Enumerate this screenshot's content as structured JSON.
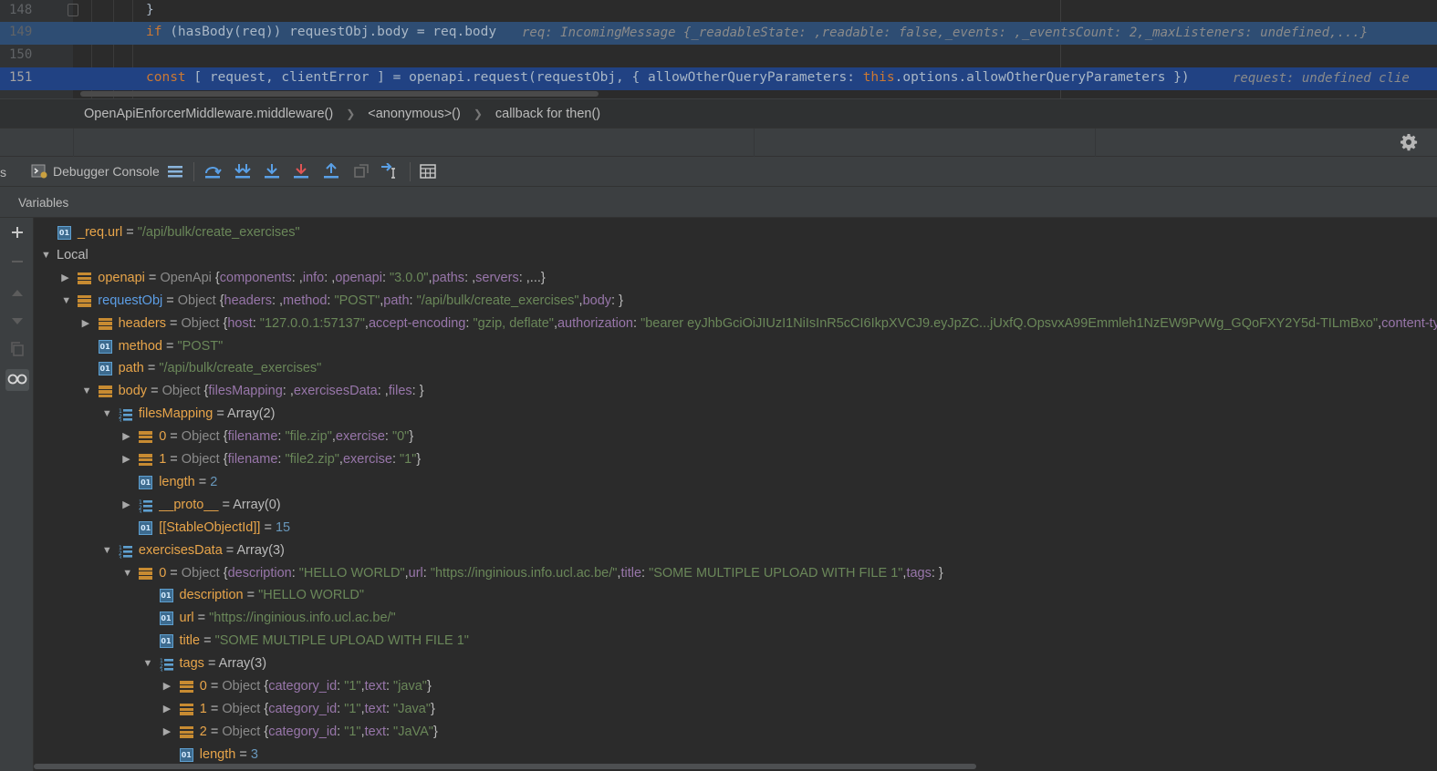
{
  "editor": {
    "lines": [
      {
        "num": "148",
        "code": "}"
      },
      {
        "num": "149",
        "code_kw": "if",
        "code_rest": " (hasBody(req)) requestObj.body = req.body",
        "inline": "req: IncomingMessage {_readableState: ,readable: false,_events: ,_eventsCount: 2,_maxListeners: undefined,...}"
      },
      {
        "num": "150",
        "code": ""
      },
      {
        "num": "151",
        "code_kw": "const",
        "code_mid": " [ request, clientError ] = openapi.request(requestObj, { allowOtherQueryParameters: ",
        "code_this": "this",
        "code_tail": ".options.allowOtherQueryParameters })",
        "inline": "request: undefined  clie"
      }
    ]
  },
  "breadcrumb": [
    "OpenApiEnforcerMiddleware.middleware()",
    "<anonymous>()",
    "callback for then()"
  ],
  "toolbar": {
    "console_label": "Debugger Console",
    "left_cut": "s"
  },
  "variables_title": "Variables",
  "tree": [
    {
      "depth": 0,
      "arrow": "",
      "icon": "prim",
      "name": "_req.url",
      "nameStyle": "orange",
      "value": [
        [
          "str",
          "\"/api/bulk/create_exercises\""
        ]
      ]
    },
    {
      "depth": 0,
      "arrow": "down",
      "icon": "",
      "name": "Local",
      "nameStyle": "plain",
      "value": []
    },
    {
      "depth": 1,
      "arrow": "right",
      "icon": "obj",
      "name": "openapi",
      "nameStyle": "orange",
      "value": [
        [
          "typ",
          "OpenApi "
        ],
        [
          "plain",
          "{"
        ],
        [
          "key",
          "components"
        ],
        [
          "plain",
          ": ,"
        ],
        [
          "key",
          "info"
        ],
        [
          "plain",
          ": ,"
        ],
        [
          "key",
          "openapi"
        ],
        [
          "plain",
          ": "
        ],
        [
          "str",
          "\"3.0.0\""
        ],
        [
          "plain",
          ","
        ],
        [
          "key",
          "paths"
        ],
        [
          "plain",
          ": ,"
        ],
        [
          "key",
          "servers"
        ],
        [
          "plain",
          ": ,...}"
        ]
      ]
    },
    {
      "depth": 1,
      "arrow": "down",
      "icon": "obj",
      "name": "requestObj",
      "nameStyle": "sel",
      "value": [
        [
          "typ",
          "Object "
        ],
        [
          "plain",
          "{"
        ],
        [
          "key",
          "headers"
        ],
        [
          "plain",
          ": ,"
        ],
        [
          "key",
          "method"
        ],
        [
          "plain",
          ": "
        ],
        [
          "str",
          "\"POST\""
        ],
        [
          "plain",
          ","
        ],
        [
          "key",
          "path"
        ],
        [
          "plain",
          ": "
        ],
        [
          "str",
          "\"/api/bulk/create_exercises\""
        ],
        [
          "plain",
          ","
        ],
        [
          "key",
          "body"
        ],
        [
          "plain",
          ": }"
        ]
      ]
    },
    {
      "depth": 2,
      "arrow": "right",
      "icon": "obj",
      "name": "headers",
      "nameStyle": "orange",
      "value": [
        [
          "typ",
          "Object "
        ],
        [
          "plain",
          "{"
        ],
        [
          "key",
          "host"
        ],
        [
          "plain",
          ": "
        ],
        [
          "str",
          "\"127.0.0.1:57137\""
        ],
        [
          "plain",
          ","
        ],
        [
          "key",
          "accept-encoding"
        ],
        [
          "plain",
          ": "
        ],
        [
          "str",
          "\"gzip, deflate\""
        ],
        [
          "plain",
          ","
        ],
        [
          "key",
          "authorization"
        ],
        [
          "plain",
          ": "
        ],
        [
          "str",
          "\"bearer eyJhbGciOiJIUzI1NiIsInR5cCI6IkpXVCJ9.eyJpZC...jUxfQ.OpsvxA99Emmleh1NzEW9PvWg_GQoFXY2Y5d-TILmBxo\""
        ],
        [
          "plain",
          ","
        ],
        [
          "key",
          "content-typ"
        ]
      ]
    },
    {
      "depth": 2,
      "arrow": "",
      "icon": "prim",
      "name": "method",
      "nameStyle": "orange",
      "value": [
        [
          "str",
          "\"POST\""
        ]
      ]
    },
    {
      "depth": 2,
      "arrow": "",
      "icon": "prim",
      "name": "path",
      "nameStyle": "orange",
      "value": [
        [
          "str",
          "\"/api/bulk/create_exercises\""
        ]
      ]
    },
    {
      "depth": 2,
      "arrow": "down",
      "icon": "obj",
      "name": "body",
      "nameStyle": "orange",
      "value": [
        [
          "typ",
          "Object "
        ],
        [
          "plain",
          "{"
        ],
        [
          "key",
          "filesMapping"
        ],
        [
          "plain",
          ": ,"
        ],
        [
          "key",
          "exercisesData"
        ],
        [
          "plain",
          ": ,"
        ],
        [
          "key",
          "files"
        ],
        [
          "plain",
          ": }"
        ]
      ]
    },
    {
      "depth": 3,
      "arrow": "down",
      "icon": "arr",
      "name": "filesMapping",
      "nameStyle": "orange",
      "value": [
        [
          "plain",
          "Array(2)"
        ]
      ]
    },
    {
      "depth": 4,
      "arrow": "right",
      "icon": "obj",
      "name": "0",
      "nameStyle": "orange",
      "value": [
        [
          "typ",
          "Object "
        ],
        [
          "plain",
          "{"
        ],
        [
          "key",
          "filename"
        ],
        [
          "plain",
          ": "
        ],
        [
          "str",
          "\"file.zip\""
        ],
        [
          "plain",
          ","
        ],
        [
          "key",
          "exercise"
        ],
        [
          "plain",
          ": "
        ],
        [
          "str",
          "\"0\""
        ],
        [
          "plain",
          "}"
        ]
      ]
    },
    {
      "depth": 4,
      "arrow": "right",
      "icon": "obj",
      "name": "1",
      "nameStyle": "orange",
      "value": [
        [
          "typ",
          "Object "
        ],
        [
          "plain",
          "{"
        ],
        [
          "key",
          "filename"
        ],
        [
          "plain",
          ": "
        ],
        [
          "str",
          "\"file2.zip\""
        ],
        [
          "plain",
          ","
        ],
        [
          "key",
          "exercise"
        ],
        [
          "plain",
          ": "
        ],
        [
          "str",
          "\"1\""
        ],
        [
          "plain",
          "}"
        ]
      ]
    },
    {
      "depth": 4,
      "arrow": "",
      "icon": "prim",
      "name": "length",
      "nameStyle": "orange",
      "value": [
        [
          "num",
          "2"
        ]
      ]
    },
    {
      "depth": 4,
      "arrow": "right",
      "icon": "arr",
      "name": "__proto__",
      "nameStyle": "orange",
      "value": [
        [
          "plain",
          "Array(0)"
        ]
      ]
    },
    {
      "depth": 4,
      "arrow": "",
      "icon": "prim",
      "name": "[[StableObjectId]]",
      "nameStyle": "orange",
      "value": [
        [
          "num",
          "15"
        ]
      ]
    },
    {
      "depth": 3,
      "arrow": "down",
      "icon": "arr",
      "name": "exercisesData",
      "nameStyle": "orange",
      "value": [
        [
          "plain",
          "Array(3)"
        ]
      ]
    },
    {
      "depth": 4,
      "arrow": "down",
      "icon": "obj",
      "name": "0",
      "nameStyle": "orange",
      "value": [
        [
          "typ",
          "Object "
        ],
        [
          "plain",
          "{"
        ],
        [
          "key",
          "description"
        ],
        [
          "plain",
          ": "
        ],
        [
          "str",
          "\"HELLO WORLD\""
        ],
        [
          "plain",
          ","
        ],
        [
          "key",
          "url"
        ],
        [
          "plain",
          ": "
        ],
        [
          "str",
          "\"https://inginious.info.ucl.ac.be/\""
        ],
        [
          "plain",
          ","
        ],
        [
          "key",
          "title"
        ],
        [
          "plain",
          ": "
        ],
        [
          "str",
          "\"SOME MULTIPLE UPLOAD WITH FILE 1\""
        ],
        [
          "plain",
          ","
        ],
        [
          "key",
          "tags"
        ],
        [
          "plain",
          ": }"
        ]
      ]
    },
    {
      "depth": 5,
      "arrow": "",
      "icon": "prim",
      "name": "description",
      "nameStyle": "orange",
      "value": [
        [
          "str",
          "\"HELLO WORLD\""
        ]
      ]
    },
    {
      "depth": 5,
      "arrow": "",
      "icon": "prim",
      "name": "url",
      "nameStyle": "orange",
      "value": [
        [
          "str",
          "\"https://inginious.info.ucl.ac.be/\""
        ]
      ]
    },
    {
      "depth": 5,
      "arrow": "",
      "icon": "prim",
      "name": "title",
      "nameStyle": "orange",
      "value": [
        [
          "str",
          "\"SOME MULTIPLE UPLOAD WITH FILE 1\""
        ]
      ]
    },
    {
      "depth": 5,
      "arrow": "down",
      "icon": "arr",
      "name": "tags",
      "nameStyle": "orange",
      "value": [
        [
          "plain",
          "Array(3)"
        ]
      ]
    },
    {
      "depth": 6,
      "arrow": "right",
      "icon": "obj",
      "name": "0",
      "nameStyle": "orange",
      "value": [
        [
          "typ",
          "Object "
        ],
        [
          "plain",
          "{"
        ],
        [
          "key",
          "category_id"
        ],
        [
          "plain",
          ": "
        ],
        [
          "str",
          "\"1\""
        ],
        [
          "plain",
          ","
        ],
        [
          "key",
          "text"
        ],
        [
          "plain",
          ": "
        ],
        [
          "str",
          "\"java\""
        ],
        [
          "plain",
          "}"
        ]
      ]
    },
    {
      "depth": 6,
      "arrow": "right",
      "icon": "obj",
      "name": "1",
      "nameStyle": "orange",
      "value": [
        [
          "typ",
          "Object "
        ],
        [
          "plain",
          "{"
        ],
        [
          "key",
          "category_id"
        ],
        [
          "plain",
          ": "
        ],
        [
          "str",
          "\"1\""
        ],
        [
          "plain",
          ","
        ],
        [
          "key",
          "text"
        ],
        [
          "plain",
          ": "
        ],
        [
          "str",
          "\"Java\""
        ],
        [
          "plain",
          "}"
        ]
      ]
    },
    {
      "depth": 6,
      "arrow": "right",
      "icon": "obj",
      "name": "2",
      "nameStyle": "orange",
      "value": [
        [
          "typ",
          "Object "
        ],
        [
          "plain",
          "{"
        ],
        [
          "key",
          "category_id"
        ],
        [
          "plain",
          ": "
        ],
        [
          "str",
          "\"1\""
        ],
        [
          "plain",
          ","
        ],
        [
          "key",
          "text"
        ],
        [
          "plain",
          ": "
        ],
        [
          "str",
          "\"JaVA\""
        ],
        [
          "plain",
          "}"
        ]
      ]
    },
    {
      "depth": 6,
      "arrow": "",
      "icon": "prim",
      "name": "length",
      "nameStyle": "orange",
      "value": [
        [
          "num",
          "3"
        ]
      ]
    }
  ],
  "icons": {
    "primitive": "01",
    "settings": "gear-icon"
  },
  "colors": {
    "string": "#6a8759",
    "number": "#6897bb",
    "key": "#9876aa",
    "name": "#e8a54a",
    "selected_line": "#214283"
  }
}
